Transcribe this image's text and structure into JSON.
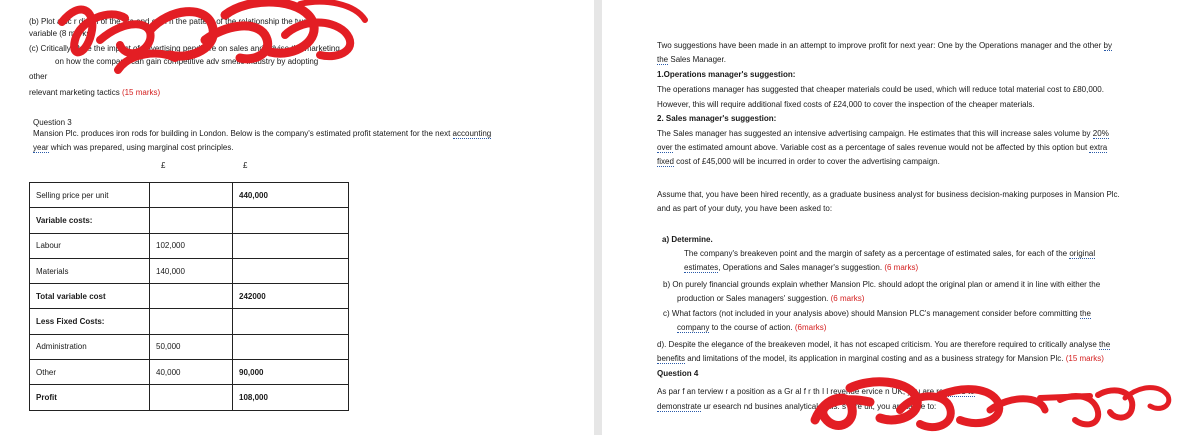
{
  "left_page": {
    "q_b_fragment": "(b) Plot a sc    r di   am of the   ata and com        n the pattern of the relationship   the two",
    "q_b_fragment2": "variable   (8 marks)",
    "q_c_fragment": "(c) Critically   alyse the impact of advertising   penditure on sales and advise the marketing",
    "q_c_fragment2": "on how the company can gain competitive adv                      smetic industry by adopting",
    "q_c_other": "other",
    "q_c_tactics": "relevant marketing tactics",
    "q_c_marks": "(15 marks)",
    "q3_title": "Question 3",
    "q3_intro_a": "Mansion Plc. produces iron rods for building in London. Below is the company's estimated profit statement for the next",
    "q3_intro_link1": "accounting",
    "q3_intro_link2": "year",
    "q3_intro_b": "which was prepared, using marginal cost principles.",
    "table": {
      "col_header_1": "£",
      "col_header_2": "£",
      "rows": [
        {
          "label": "Selling price per unit",
          "col1": "",
          "col2": "440,000",
          "bold_label": false,
          "bold_col2": true
        },
        {
          "label": "Variable costs:",
          "col1": "",
          "col2": "",
          "bold_label": true,
          "bold_col2": false
        },
        {
          "label": "Labour",
          "col1": "102,000",
          "col2": "",
          "bold_label": false,
          "bold_col2": false
        },
        {
          "label": "Materials",
          "col1": "140,000",
          "col2": "",
          "bold_label": false,
          "bold_col2": false
        },
        {
          "label": "Total variable cost",
          "col1": "",
          "col2": "242000",
          "bold_label": true,
          "bold_col2": true
        },
        {
          "label": "Less Fixed Costs:",
          "col1": "",
          "col2": "",
          "bold_label": true,
          "bold_col2": false
        },
        {
          "label": "Administration",
          "col1": "50,000",
          "col2": "",
          "bold_label": false,
          "bold_col2": false
        },
        {
          "label": "Other",
          "col1": "40,000",
          "col2": "90,000",
          "bold_label": false,
          "bold_col2": true
        },
        {
          "label": "Profit",
          "col1": "",
          "col2": "108,000",
          "bold_label": true,
          "bold_col2": true
        }
      ]
    }
  },
  "right_page": {
    "intro_a": "Two suggestions have been made in an attempt to improve profit for next year: One by the Operations manager and the other",
    "intro_link1": "by",
    "intro_link2": "the",
    "intro_b": "Sales Manager.",
    "s1_heading": "1.Operations manager's suggestion:",
    "s1_line1": "The operations manager has suggested that cheaper materials could be used, which will reduce total material cost to £80,000.",
    "s1_line2": "However, this will require additional fixed costs of £24,000 to cover the inspection of the cheaper materials.",
    "s2_heading": "2.  Sales manager's suggestion:",
    "s2_line1": "The Sales manager has suggested an intensive advertising campaign. He estimates that this will increase sales volume by",
    "s2_line1_link": "20%",
    "s2_line2_link": "over",
    "s2_line2": "the estimated amount above. Variable cost as a percentage of sales revenue would not be affected by this option but",
    "s2_line2_link2": "extra",
    "s2_line3_link": "fixed",
    "s2_line3": "cost of £45,000 will be incurred in order to cover the advertising campaign.",
    "assume_line1": "Assume that, you have been hired recently, as a graduate business analyst for business decision-making purposes in Mansion Plc.",
    "assume_line2": "and as part of your duty, you have been asked to:",
    "a_heading": "a) Determine.",
    "a_line1": "The company's breakeven point and the margin of safety as a percentage of estimated sales, for each of the",
    "a_line1_link": "original",
    "a_line2_link": "estimates",
    "a_line2": ", Operations and Sales manager's suggestion.",
    "a_marks": "(6 marks)",
    "b_line1": "b) On purely financial grounds explain whether Mansion Plc. should adopt the original plan or amend it in line with either the",
    "b_line2": "production or Sales managers' suggestion.",
    "b_marks": "(6 marks)",
    "c_line1": "c) What factors (not included in your analysis above) should Mansion PLC's management consider before committing",
    "c_line1_link": "the",
    "c_line2_link": "company",
    "c_line2": "to the course of action.",
    "c_marks": "(6marks)",
    "d_line1": "d).  Despite the elegance of the breakeven model, it has not escaped criticism. You are therefore required to critically analyse",
    "d_line1_link": "the",
    "d_line2_link": "benefits",
    "d_line2": "and limitations of the model, its application in marginal costing and as a business strategy for Mansion Plc.",
    "d_marks": "(15 marks)",
    "q4_title": "Question 4",
    "q4_line1": "As par   f an   terview   r a position as a Gr                   al     f r  th   I        l revenue   ervice   n UK, you are",
    "q4_line1_link": "required to",
    "q4_line2_link": "demonstrate",
    "q4_line2": "  ur   esearch   nd busines  analytical skills.   s a re  ult, you are taske   to:"
  },
  "colors": {
    "scribble": "#e31e24",
    "marks_text": "#d42020",
    "link_underline": "#2a5aa8"
  }
}
